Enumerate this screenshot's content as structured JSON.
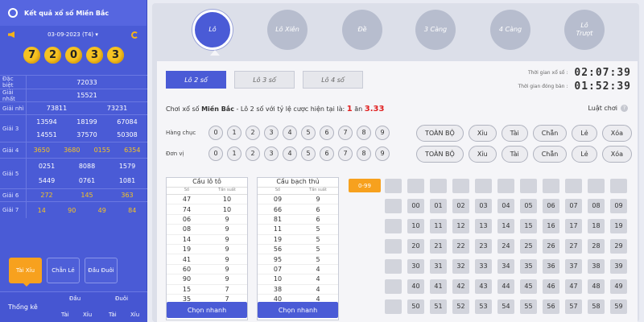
{
  "left": {
    "title": "Kết quả xổ số Miền Bắc",
    "date": "03-09-2023 (T4)",
    "balls": [
      "7",
      "2",
      "0",
      "3",
      "3"
    ],
    "prizes": [
      {
        "label": "Đặc biệt",
        "values": [
          "72033"
        ]
      },
      {
        "label": "Giải nhất",
        "values": [
          "15521"
        ]
      },
      {
        "label": "Giải nhì",
        "values": [
          "73811",
          "73231"
        ]
      },
      {
        "label": "Giải 3",
        "values": [
          "13594",
          "18199",
          "67084",
          "14551",
          "37570",
          "50308"
        ]
      },
      {
        "label": "Giải 4",
        "values": [
          "3650",
          "3680",
          "0155",
          "6354"
        ]
      },
      {
        "label": "Giải 5",
        "values": [
          "0251",
          "8088",
          "1579",
          "5449",
          "0761",
          "1081"
        ]
      },
      {
        "label": "Giải 6",
        "values": [
          "272",
          "145",
          "363"
        ]
      },
      {
        "label": "Giải 7",
        "values": [
          "14",
          "90",
          "49",
          "84"
        ]
      }
    ],
    "tabs": [
      "Tài Xỉu",
      "Chẵn Lẻ",
      "Đầu Đuôi"
    ],
    "bottom": {
      "label": "Thống kê",
      "head1": "Đầu",
      "head2": "Đuôi",
      "sub": [
        "Tài",
        "Xỉu",
        "Tài",
        "Xỉu"
      ]
    }
  },
  "games": [
    "Lô",
    "Lô Xiên",
    "Đề",
    "3 Càng",
    "4 Càng",
    "Lô Trượt"
  ],
  "subtabs": [
    "Lô 2 số",
    "Lô 3 số",
    "Lô 4 số"
  ],
  "timers": [
    {
      "label": "Thời gian xổ số :",
      "value": "02:07:39"
    },
    {
      "label": "Thời gian đóng bàn :",
      "value": "01:52:39"
    }
  ],
  "instruction": {
    "prefix": "Chơi xổ số ",
    "region": "Miền Bắc",
    "middle": " - Lô 2 số với tỷ lệ cược hiện tại là:",
    "rate_a": "1",
    "rate_mid": " ăn ",
    "rate_b": "3.33"
  },
  "help_label": "Luật chơi",
  "rows": [
    {
      "label": "Hàng chục",
      "digits": [
        "0",
        "1",
        "2",
        "3",
        "4",
        "5",
        "6",
        "7",
        "8",
        "9"
      ],
      "options": [
        "TOÀN BỘ",
        "Xỉu",
        "Tài",
        "Chẵn",
        "Lẻ",
        "Xóa"
      ]
    },
    {
      "label": "Đơn vị",
      "digits": [
        "0",
        "1",
        "2",
        "3",
        "4",
        "5",
        "6",
        "7",
        "8",
        "9"
      ],
      "options": [
        "TOÀN BỘ",
        "Xỉu",
        "Tài",
        "Chẵn",
        "Lẻ",
        "Xóa"
      ]
    }
  ],
  "table1": {
    "title": "Cầu lô tô",
    "cols": [
      "Số",
      "Tần suất"
    ],
    "rows": [
      [
        "47",
        "10"
      ],
      [
        "74",
        "10"
      ],
      [
        "06",
        "9"
      ],
      [
        "08",
        "9"
      ],
      [
        "14",
        "9"
      ],
      [
        "19",
        "9"
      ],
      [
        "41",
        "9"
      ],
      [
        "60",
        "9"
      ],
      [
        "90",
        "9"
      ],
      [
        "15",
        "7"
      ],
      [
        "35",
        "7"
      ]
    ],
    "button": "Chọn nhanh"
  },
  "table2": {
    "title": "Cầu bạch thủ",
    "cols": [
      "Số",
      "Tần suất"
    ],
    "rows": [
      [
        "09",
        "9"
      ],
      [
        "66",
        "6"
      ],
      [
        "81",
        "6"
      ],
      [
        "11",
        "5"
      ],
      [
        "19",
        "5"
      ],
      [
        "56",
        "5"
      ],
      [
        "95",
        "5"
      ],
      [
        "07",
        "4"
      ],
      [
        "10",
        "4"
      ],
      [
        "38",
        "4"
      ],
      [
        "40",
        "4"
      ]
    ],
    "button": "Chọn nhanh"
  },
  "range_label": "0-99",
  "numbers": [
    [
      "",
      "",
      "",
      "",
      "",
      "",
      "",
      "",
      "",
      "",
      ""
    ],
    [
      "",
      "00",
      "01",
      "02",
      "03",
      "04",
      "05",
      "06",
      "07",
      "08",
      "09"
    ],
    [
      "",
      "10",
      "11",
      "12",
      "13",
      "14",
      "15",
      "16",
      "17",
      "18",
      "19"
    ],
    [
      "",
      "20",
      "21",
      "22",
      "23",
      "24",
      "25",
      "26",
      "27",
      "28",
      "29"
    ],
    [
      "",
      "30",
      "31",
      "32",
      "33",
      "34",
      "35",
      "36",
      "37",
      "38",
      "39"
    ],
    [
      "",
      "40",
      "41",
      "42",
      "43",
      "44",
      "45",
      "46",
      "47",
      "48",
      "49"
    ],
    [
      "",
      "50",
      "51",
      "52",
      "53",
      "54",
      "55",
      "56",
      "57",
      "58",
      "59"
    ]
  ],
  "colors": {
    "primary": "#4a5bd6",
    "accent": "#f7a11e",
    "ball": "#f6c323",
    "rate": "#e02020"
  }
}
